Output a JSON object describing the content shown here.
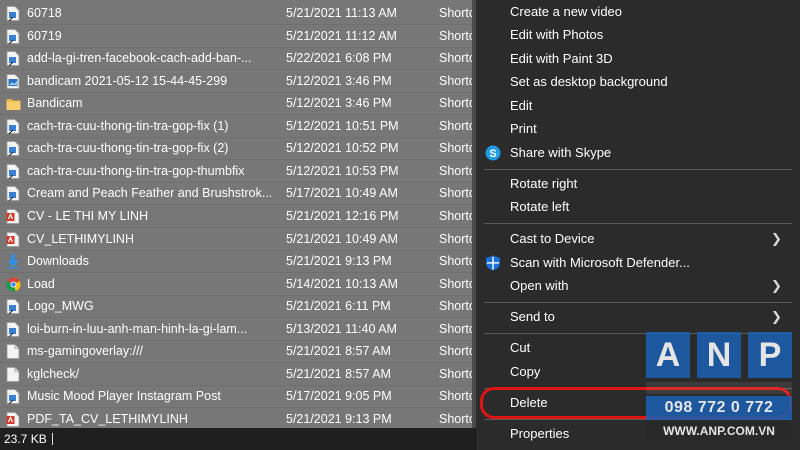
{
  "files": [
    {
      "name": "60718",
      "date": "5/21/2021 11:13 AM",
      "type": "Shortcut",
      "icon": "doc-shortcut-icon"
    },
    {
      "name": "60719",
      "date": "5/21/2021 11:12 AM",
      "type": "Shortcut",
      "icon": "doc-shortcut-icon"
    },
    {
      "name": "add-la-gi-tren-facebook-cach-add-ban-...",
      "date": "5/22/2021 6:08 PM",
      "type": "Shortcut",
      "icon": "doc-shortcut-icon"
    },
    {
      "name": "bandicam 2021-05-12 15-44-45-299",
      "date": "5/12/2021 3:46 PM",
      "type": "Shortcut",
      "icon": "image-shortcut-icon"
    },
    {
      "name": "Bandicam",
      "date": "5/12/2021 3:46 PM",
      "type": "Shortcut",
      "icon": "folder-icon"
    },
    {
      "name": "cach-tra-cuu-thong-tin-tra-gop-fix (1)",
      "date": "5/12/2021 10:51 PM",
      "type": "Shortcut",
      "icon": "doc-shortcut-icon"
    },
    {
      "name": "cach-tra-cuu-thong-tin-tra-gop-fix (2)",
      "date": "5/12/2021 10:52 PM",
      "type": "Shortcut",
      "icon": "doc-shortcut-icon"
    },
    {
      "name": "cach-tra-cuu-thong-tin-tra-gop-thumbfix",
      "date": "5/12/2021 10:53 PM",
      "type": "Shortcut",
      "icon": "doc-shortcut-icon"
    },
    {
      "name": "Cream and Peach Feather and Brushstrok...",
      "date": "5/17/2021 10:49 AM",
      "type": "Shortcut",
      "icon": "doc-shortcut-icon"
    },
    {
      "name": "CV - LE THI MY LINH",
      "date": "5/21/2021 12:16 PM",
      "type": "Shortcut",
      "icon": "pdf-icon"
    },
    {
      "name": "CV_LETHIMYLINH",
      "date": "5/21/2021 10:49 AM",
      "type": "Shortcut",
      "icon": "pdf-icon"
    },
    {
      "name": "Downloads",
      "date": "5/21/2021 9:13 PM",
      "type": "Shortcut",
      "icon": "download-arrow-icon"
    },
    {
      "name": "Load",
      "date": "5/14/2021 10:13 AM",
      "type": "Shortcut",
      "icon": "chrome-icon"
    },
    {
      "name": "Logo_MWG",
      "date": "5/21/2021 6:11 PM",
      "type": "Shortcut",
      "icon": "doc-shortcut-icon"
    },
    {
      "name": "loi-burn-in-luu-anh-man-hinh-la-gi-lam...",
      "date": "5/13/2021 11:40 AM",
      "type": "Shortcut",
      "icon": "doc-shortcut-icon"
    },
    {
      "name": "ms-gamingoverlay:///",
      "date": "5/21/2021 8:57 AM",
      "type": "Shortcut",
      "icon": "blank-doc-icon"
    },
    {
      "name": "kglcheck/",
      "date": "5/21/2021 8:57 AM",
      "type": "Shortcut",
      "icon": "blank-doc-icon"
    },
    {
      "name": "Music Mood Player Instagram Post",
      "date": "5/17/2021 9:05 PM",
      "type": "Shortcut",
      "icon": "doc-shortcut-icon"
    },
    {
      "name": "PDF_TA_CV_LETHIMYLINH",
      "date": "5/21/2021 9:13 PM",
      "type": "Shortcut",
      "icon": "pdf-icon"
    }
  ],
  "status_bar": {
    "selection_size": "23.7 KB"
  },
  "context_menu": {
    "create_new_video": "Create a new video",
    "edit_with_photos": "Edit with Photos",
    "edit_with_paint3d": "Edit with Paint 3D",
    "set_desktop_background": "Set as desktop background",
    "edit": "Edit",
    "print": "Print",
    "share_with_skype": "Share with Skype",
    "rotate_right": "Rotate right",
    "rotate_left": "Rotate left",
    "cast_to_device": "Cast to Device",
    "scan_defender": "Scan with Microsoft Defender...",
    "open_with": "Open with",
    "send_to": "Send to",
    "cut": "Cut",
    "copy": "Copy",
    "delete": "Delete",
    "properties": "Properties"
  },
  "watermark": {
    "letters": [
      "A",
      "N",
      "P"
    ],
    "phone": "098 772 0 772",
    "website": "WWW.ANP.COM.VN"
  },
  "colors": {
    "list_background": "#777777",
    "menu_background": "#2b2b2b",
    "highlight": "#e01414",
    "watermark_blue": "#1c5fb0",
    "skype_blue": "#1e9be5"
  }
}
